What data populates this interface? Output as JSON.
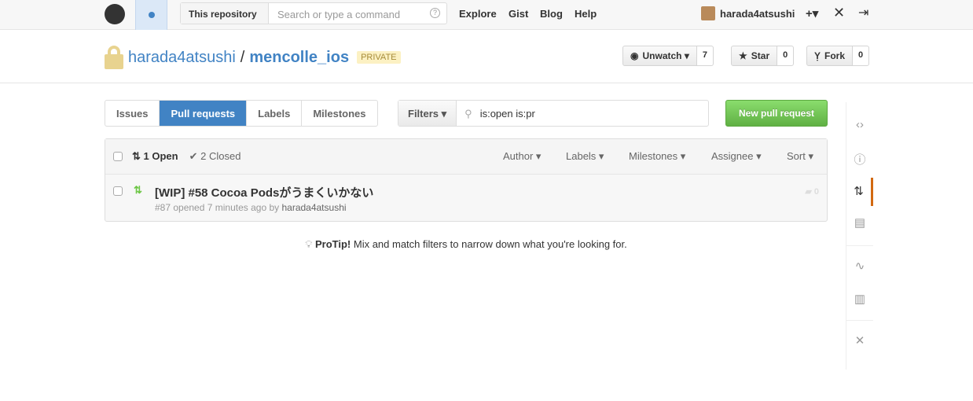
{
  "header": {
    "scope": "This repository",
    "search_placeholder": "Search or type a command",
    "help": "?",
    "nav": [
      "Explore",
      "Gist",
      "Blog",
      "Help"
    ],
    "username": "harada4atsushi",
    "plus": "+▾"
  },
  "repo": {
    "owner": "harada4atsushi",
    "sep": "/",
    "name": "mencolle_ios",
    "badge": "PRIVATE"
  },
  "actions": {
    "unwatch": "Unwatch ▾",
    "unwatch_count": "7",
    "star": "Star",
    "star_count": "0",
    "fork": "Fork",
    "fork_count": "0"
  },
  "tabs": [
    "Issues",
    "Pull requests",
    "Labels",
    "Milestones"
  ],
  "filters": {
    "label": "Filters ▾",
    "query": "is:open is:pr"
  },
  "new_pr": "New pull request",
  "list": {
    "open": "1 Open",
    "closed": "2 Closed",
    "filters": [
      "Author ▾",
      "Labels ▾",
      "Milestones ▾",
      "Assignee ▾",
      "Sort ▾"
    ],
    "items": [
      {
        "title": "[WIP] #58 Cocoa Podsがうまくいかない",
        "meta": "#87 opened 7 minutes ago by",
        "author": "harada4atsushi",
        "comments": "0"
      }
    ]
  },
  "protip": {
    "bold": "ProTip!",
    "text": " Mix and match filters to narrow down what you're looking for."
  }
}
